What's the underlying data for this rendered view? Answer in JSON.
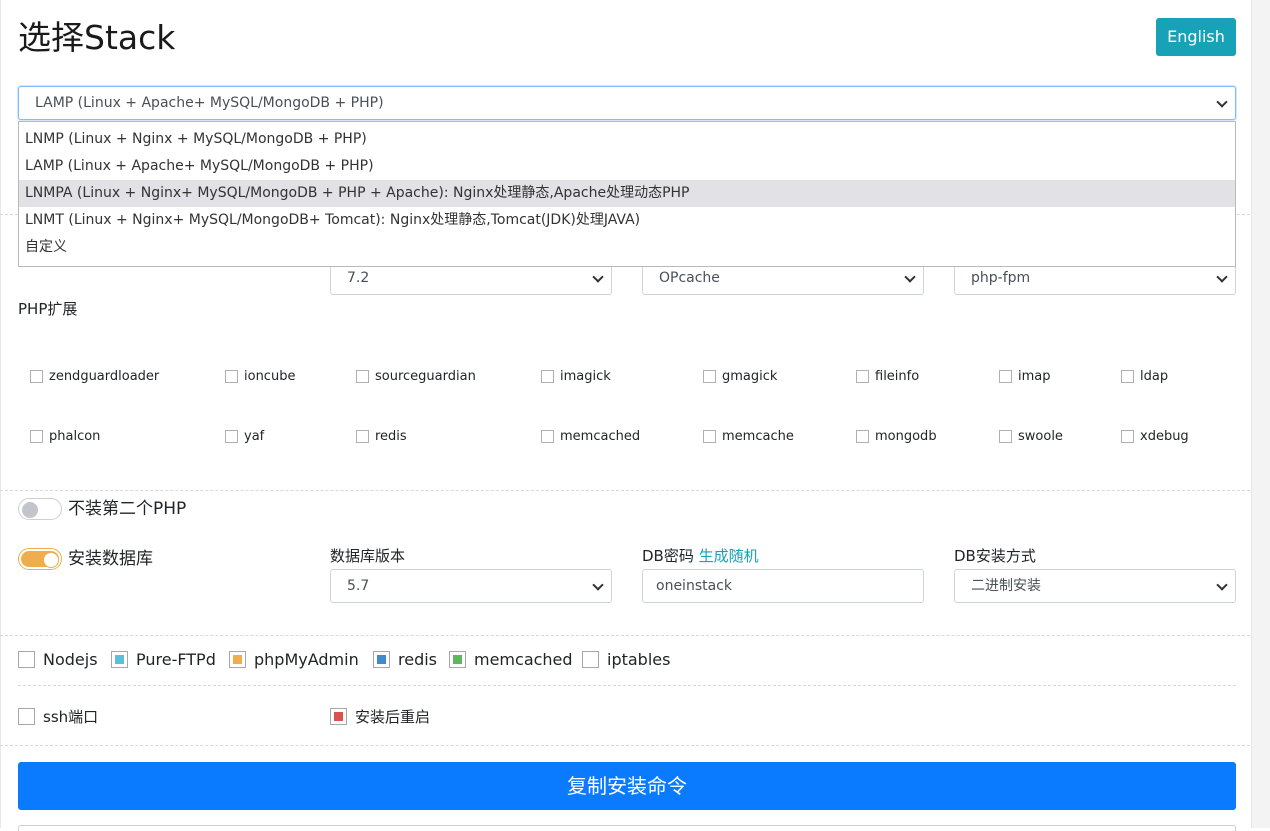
{
  "header": {
    "title": "选择Stack",
    "lang_button": "English"
  },
  "colors": {
    "accent_teal": "#17a2b8",
    "primary_blue": "#0a7bff",
    "toggle_orange": "#f0ad4e",
    "pure_ftpd": "#5bc0de",
    "phpmyadmin": "#f0ad4e",
    "redis": "#428bca",
    "memcached": "#5cb85c",
    "reboot": "#d9534f"
  },
  "stack": {
    "selected": "LAMP (Linux + Apache+ MySQL/MongoDB + PHP)",
    "options": [
      "LNMP (Linux + Nginx + MySQL/MongoDB + PHP)",
      "LAMP (Linux + Apache+ MySQL/MongoDB + PHP)",
      "LNMPA (Linux + Nginx+ MySQL/MongoDB + PHP + Apache): Nginx处理静态,Apache处理动态PHP",
      "LNMT (Linux + Nginx+ MySQL/MongoDB+ Tomcat): Nginx处理静态,Tomcat(JDK)处理JAVA)",
      "自定义"
    ],
    "highlighted_index": 2
  },
  "php": {
    "version": "7.2",
    "opcode": "OPcache",
    "mode": "php-fpm",
    "extensions_label": "PHP扩展",
    "extensions": [
      "zendguardloader",
      "ioncube",
      "sourceguardian",
      "imagick",
      "gmagick",
      "fileinfo",
      "imap",
      "ldap",
      "phalcon",
      "yaf",
      "redis",
      "memcached",
      "memcache",
      "mongodb",
      "swoole",
      "xdebug"
    ]
  },
  "second_php": {
    "label": "不装第二个PHP",
    "on": false
  },
  "database": {
    "toggle_label": "安装数据库",
    "on": true,
    "version_label": "数据库版本",
    "version": "5.7",
    "password_label": "DB密码",
    "generate_link": "生成随机",
    "password": "oneinstack",
    "install_method_label": "DB安装方式",
    "install_method": "二进制安装"
  },
  "components": [
    {
      "label": "Nodejs",
      "checked": false,
      "color": ""
    },
    {
      "label": "Pure-FTPd",
      "checked": true,
      "color": "#5bc0de"
    },
    {
      "label": "phpMyAdmin",
      "checked": true,
      "color": "#f0ad4e"
    },
    {
      "label": "redis",
      "checked": true,
      "color": "#428bca"
    },
    {
      "label": "memcached",
      "checked": true,
      "color": "#5cb85c"
    },
    {
      "label": "iptables",
      "checked": false,
      "color": ""
    }
  ],
  "misc": {
    "ssh_port": "ssh端口",
    "reboot": "安装后重启"
  },
  "action": {
    "copy_command": "复制安装命令"
  }
}
